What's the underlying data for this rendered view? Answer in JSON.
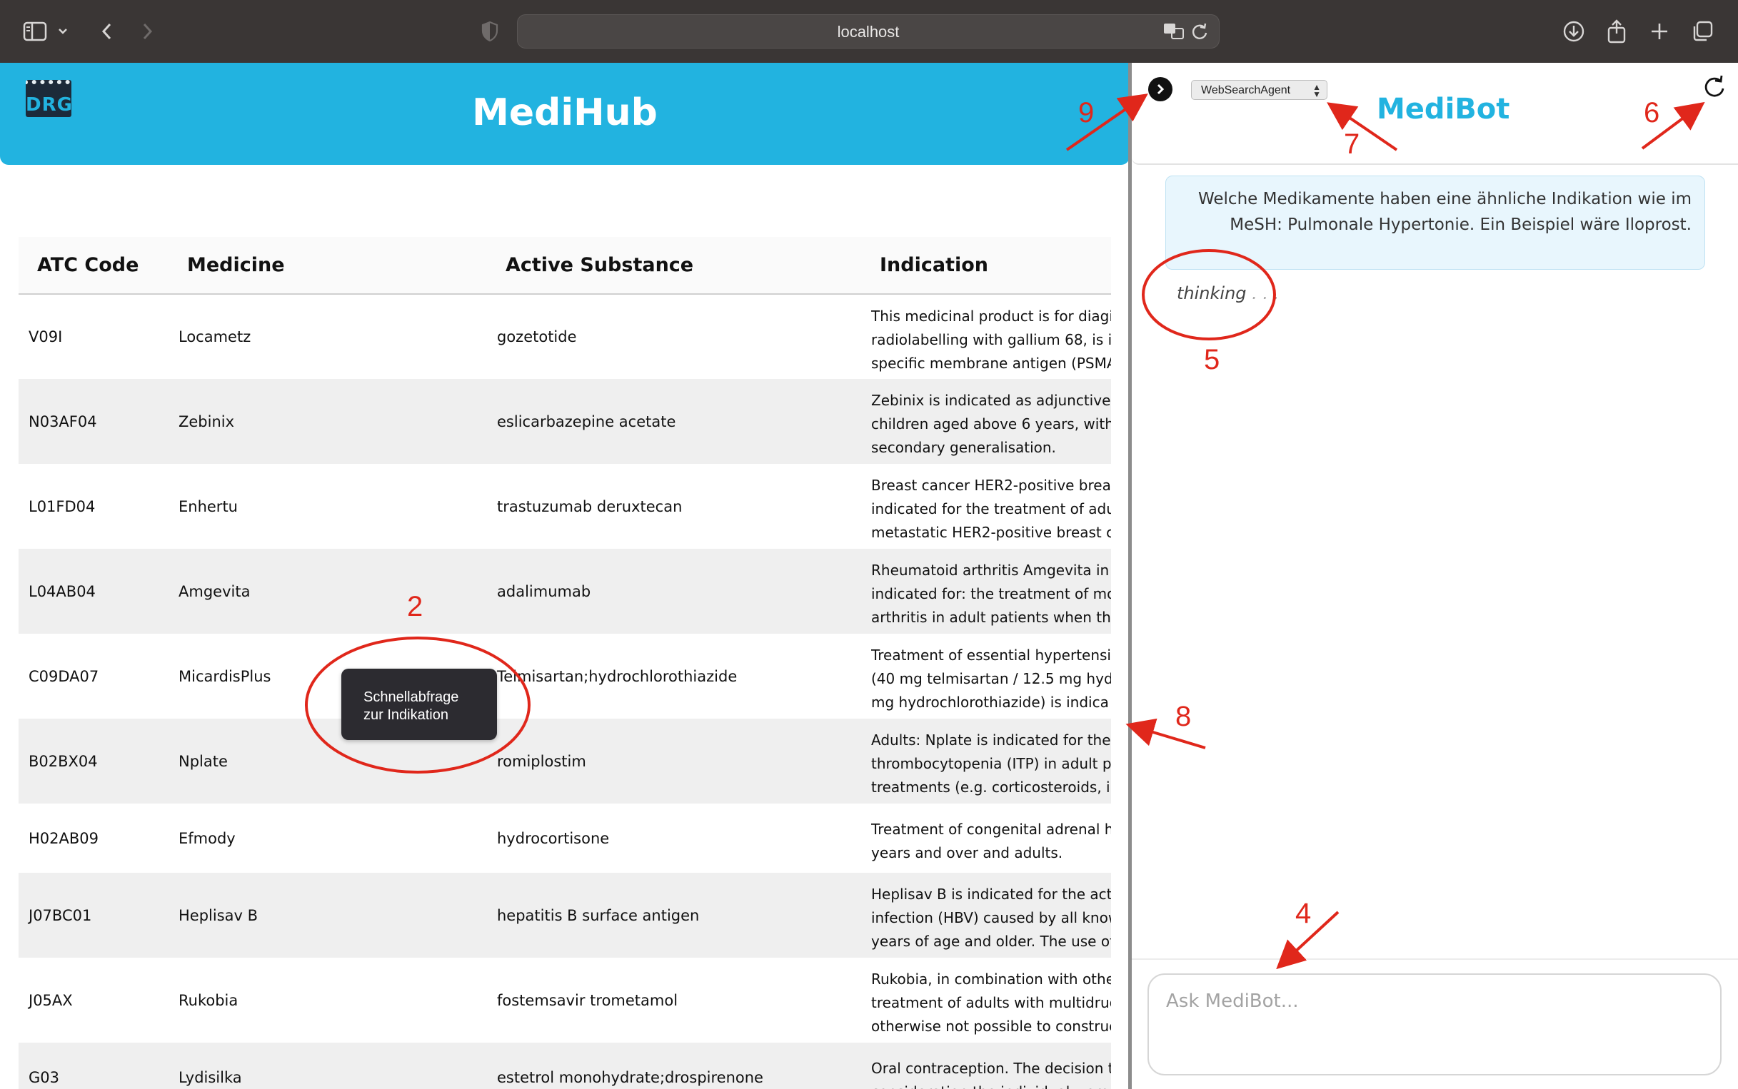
{
  "browser": {
    "url": "localhost"
  },
  "medihub": {
    "title": "MediHub",
    "logo_text": "DRG",
    "columns": [
      "ATC Code",
      "Medicine",
      "Active Substance",
      "Indication"
    ],
    "rows": [
      {
        "atc": "V09I",
        "medicine": "Locametz",
        "substance": "gozetotide",
        "indication": [
          "This medicinal product is for diagi",
          "radiolabelling with gallium 68, is ir",
          "specific membrane antigen (PSMA"
        ]
      },
      {
        "atc": "N03AF04",
        "medicine": "Zebinix",
        "substance": "eslicarbazepine acetate",
        "indication": [
          "Zebinix is indicated as adjunctive",
          "children aged above 6 years, with",
          "secondary generalisation."
        ]
      },
      {
        "atc": "L01FD04",
        "medicine": "Enhertu",
        "substance": "trastuzumab deruxtecan",
        "indication": [
          "Breast cancer HER2-positive breas",
          "indicated for the treatment of adu",
          "metastatic HER2-positive breast c"
        ]
      },
      {
        "atc": "L04AB04",
        "medicine": "Amgevita",
        "substance": "adalimumab",
        "indication": [
          "Rheumatoid arthritis  Amgevita in",
          "indicated for: the treatment of mo",
          "arthritis in adult patients when the"
        ]
      },
      {
        "atc": "C09DA07",
        "medicine": "MicardisPlus",
        "substance": "Telmisartan;hydrochlorothiazide",
        "indication": [
          "Treatment of essential hypertensi",
          "(40 mg telmisartan / 12.5 mg hydr",
          "mg hydrochlorothiazide) is indica"
        ]
      },
      {
        "atc": "B02BX04",
        "medicine": "Nplate",
        "substance": "romiplostim",
        "indication": [
          "Adults: Nplate is indicated for the",
          "thrombocytopenia  (ITP) in adult p",
          "treatments (e.g. corticosteroids, in"
        ]
      },
      {
        "atc": "H02AB09",
        "medicine": "Efmody",
        "substance": "hydrocortisone",
        "indication": [
          "Treatment of congenital adrenal h",
          "years and over and adults."
        ]
      },
      {
        "atc": "J07BC01",
        "medicine": "Heplisav B",
        "substance": "hepatitis B surface antigen",
        "indication": [
          "Heplisav B is indicated for the acti",
          "infection (HBV) caused by all know",
          "years of age and older. The use of"
        ]
      },
      {
        "atc": "J05AX",
        "medicine": "Rukobia",
        "substance": "fostemsavir trometamol",
        "indication": [
          "Rukobia, in combination with othe",
          "treatment of adults with multidrug",
          "otherwise not possible to construc"
        ]
      },
      {
        "atc": "G03",
        "medicine": "Lydisilka",
        "substance": "estetrol monohydrate;drospirenone",
        "indication": [
          "Oral contraception. The decision t",
          "consideration the individual wom"
        ]
      }
    ],
    "tooltip": [
      "Schnellabfrage",
      "zur Indikation"
    ]
  },
  "medibot": {
    "title": "MediBot",
    "agent_selected": "WebSearchAgent",
    "user_message": [
      "Welche Medikamente haben eine ähnliche Indikation wie im",
      "MeSH: Pulmonale Hypertonie. Ein Beispiel wäre Iloprost."
    ],
    "thinking_label": "thinking",
    "thinking_dots": ". . .",
    "input_placeholder": "Ask MediBot..."
  },
  "annotations": {
    "color": "#e0271b",
    "labels": [
      "2",
      "4",
      "5",
      "6",
      "7",
      "8",
      "9"
    ]
  },
  "colors": {
    "brand": "#22b3e0",
    "chrome": "#3a3635",
    "tooltip_bg": "#2c2b30",
    "user_bubble": "#e8f6fd"
  }
}
